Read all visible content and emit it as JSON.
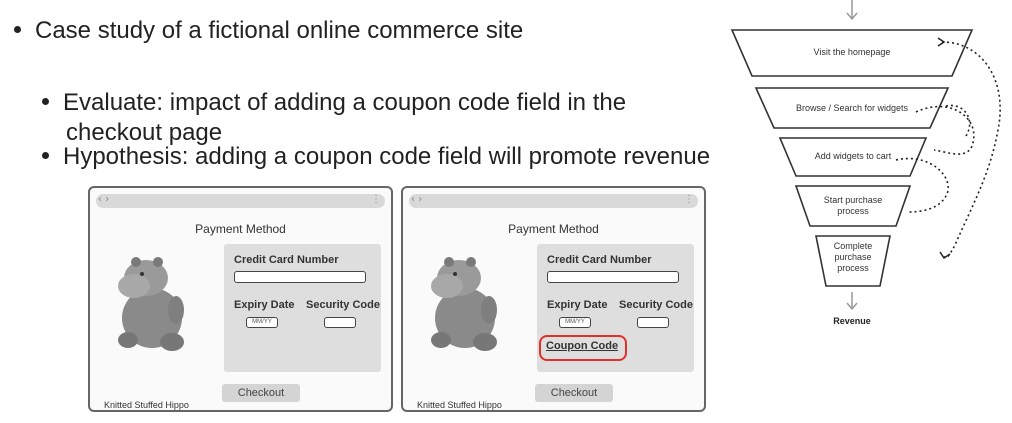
{
  "bullets": {
    "item1": "Case study of a fictional online commerce site",
    "item2_line1": "Evaluate: impact of adding a coupon code field in the",
    "item2_line2": "checkout page",
    "item3": "Hypothesis: adding a coupon code field will promote revenue"
  },
  "mockups": [
    {
      "title": "Payment Method",
      "caption": "Knitted Stuffed Hippo",
      "card_label": "Credit Card Number",
      "expiry_label": "Expiry Date",
      "expiry_placeholder": "MM/YY",
      "security_label": "Security Code",
      "checkout_label": "Checkout",
      "has_coupon": false
    },
    {
      "title": "Payment Method",
      "caption": "Knitted Stuffed Hippo",
      "card_label": "Credit Card Number",
      "expiry_label": "Expiry Date",
      "expiry_placeholder": "MM/YY",
      "security_label": "Security Code",
      "coupon_label": "Coupon Code",
      "checkout_label": "Checkout",
      "has_coupon": true
    }
  ],
  "funnel": {
    "stages": [
      "Visit the homepage",
      "Browse / Search for widgets",
      "Add widgets to cart",
      "Start purchase process",
      "Complete purchase process"
    ],
    "outcome": "Revenue"
  },
  "colors": {
    "highlight": "#e0302a",
    "form_bg": "#dedede",
    "text": "#222222"
  }
}
